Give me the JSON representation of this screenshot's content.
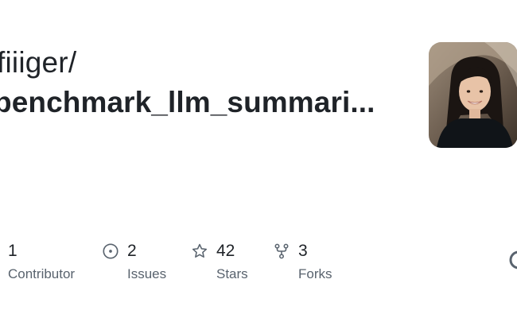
{
  "repo": {
    "owner": "fiiiger/",
    "name": "benchmark_llm_summari..."
  },
  "stats": [
    {
      "icon": "contributors-icon",
      "value": "1",
      "label": "Contributor"
    },
    {
      "icon": "issue-icon",
      "value": "2",
      "label": "Issues"
    },
    {
      "icon": "star-icon",
      "value": "42",
      "label": "Stars"
    },
    {
      "icon": "fork-icon",
      "value": "3",
      "label": "Forks"
    }
  ],
  "colors": {
    "text": "#1f2328",
    "muted": "#59636e",
    "icon": "#59636e"
  }
}
